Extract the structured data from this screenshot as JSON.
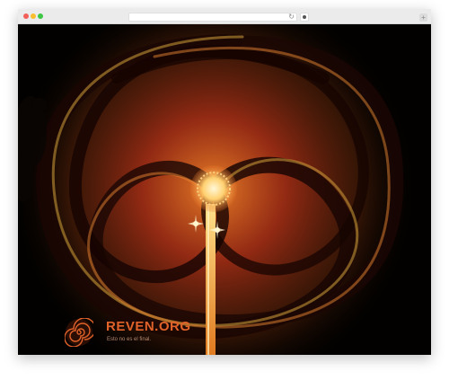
{
  "browser": {
    "reload_glyph": "↻",
    "extension_icon": "gear-icon",
    "new_tab_glyph": "+"
  },
  "site": {
    "title": "REVEN.ORG",
    "tagline": "Esto no es el final."
  },
  "colors": {
    "brand": "#e0622a",
    "background": "#000000"
  }
}
